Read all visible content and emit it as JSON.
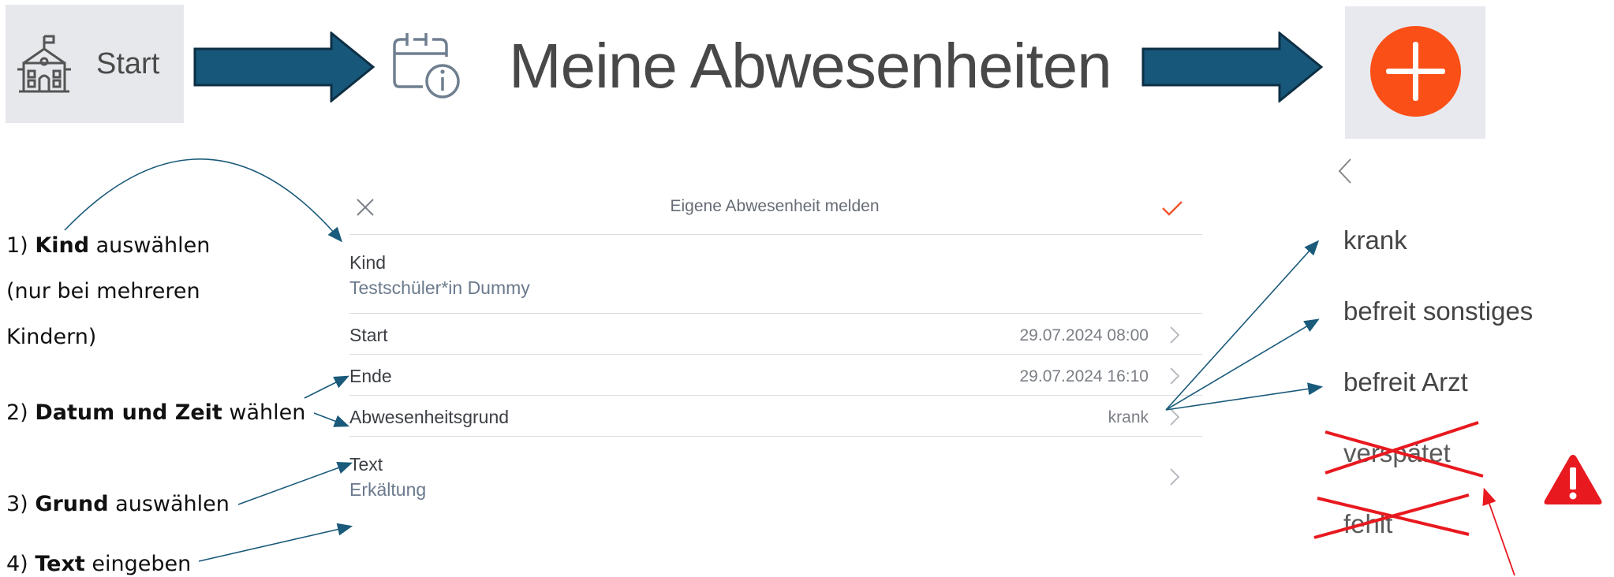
{
  "banner": {
    "start_label": "Start",
    "page_title": "Meine Abwesenheiten"
  },
  "form": {
    "title": "Eigene Abwesenheit melden",
    "kind": {
      "label": "Kind",
      "value": "Testschüler*in Dummy"
    },
    "start": {
      "label": "Start",
      "value": "29.07.2024 08:00"
    },
    "ende": {
      "label": "Ende",
      "value": "29.07.2024 16:10"
    },
    "grund": {
      "label": "Abwesenheitsgrund",
      "value": "krank"
    },
    "text": {
      "label": "Text",
      "value": "Erkältung"
    }
  },
  "steps": {
    "s1": {
      "num": "1)",
      "bold": "Kind",
      "rest": "auswählen"
    },
    "s1b": "(nur bei mehreren",
    "s1c": "Kindern)",
    "s2": {
      "num": "2)",
      "bold": "Datum und Zeit",
      "rest": "wählen"
    },
    "s3": {
      "num": "3)",
      "bold": "Grund",
      "rest": "auswählen"
    },
    "s4": {
      "num": "4)",
      "bold": "Text",
      "rest": "eingeben"
    }
  },
  "reasons": [
    {
      "label": "krank",
      "struck": false
    },
    {
      "label": "befreit sonstiges",
      "struck": false
    },
    {
      "label": "befreit Arzt",
      "struck": false
    },
    {
      "label": "verspätet",
      "struck": true
    },
    {
      "label": "fehlt",
      "struck": true
    }
  ],
  "colors": {
    "arrow": "#1a5a7a",
    "accent": "#fb4f18",
    "cross": "#e8191f",
    "warning": "#e8191f"
  },
  "icons": [
    "school-icon",
    "calendar-info-icon",
    "plus-icon",
    "close-icon",
    "check-icon",
    "chevron-right-icon",
    "chevron-left-icon",
    "warning-icon"
  ]
}
